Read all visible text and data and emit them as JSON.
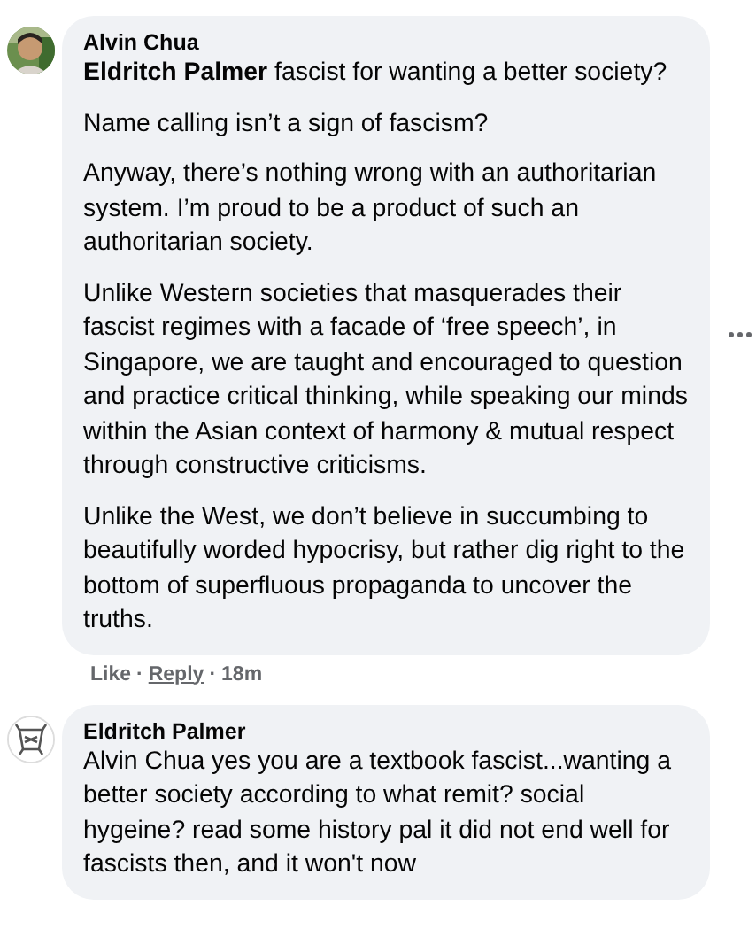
{
  "comments": [
    {
      "author": "Alvin Chua",
      "paragraphs": [
        "**Eldritch Palmer** fascist for wanting a better society?",
        "Name calling isn’t a sign of fascism?",
        "Anyway, there’s nothing wrong with an authoritarian system. I’m proud to be a product of such an authoritarian society.",
        "Unlike Western societies that masquerades their fascist regimes with a facade of ‘free speech’, in Singapore, we are taught and encouraged to question and practice critical thinking, while speaking our minds within the Asian context of harmony & mutual respect through constructive criticisms.",
        "Unlike the West, we don’t believe in succumbing to beautifully worded hypocrisy, but rather dig right to the bottom of superfluous propaganda to uncover the truths."
      ],
      "more_menu": true,
      "actions": {
        "like": "Like",
        "separator_1": "·",
        "reply": "Reply",
        "separator_2": "·",
        "time": "18m"
      }
    },
    {
      "author": "Eldritch Palmer",
      "avatar": {
        "kind": "icon"
      },
      "paragraphs": [
        "Alvin Chua yes you are a textbook fascist...wanting a better society according to what remit? social hygeine? read some history pal it did not end well for fascists then, and it won't now"
      ]
    }
  ]
}
